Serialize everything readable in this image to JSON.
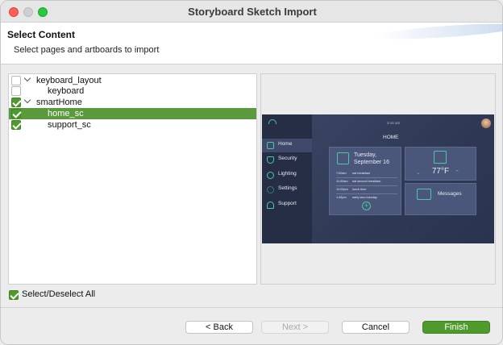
{
  "window": {
    "title": "Storyboard Sketch Import"
  },
  "header": {
    "title": "Select Content",
    "description": "Select pages and artboards to import"
  },
  "tree": {
    "items": [
      {
        "label": "keyboard_layout",
        "checked": false,
        "expanded": true,
        "level": 0,
        "selected": false
      },
      {
        "label": "keyboard",
        "checked": false,
        "level": 1,
        "selected": false
      },
      {
        "label": "smartHome",
        "checked": true,
        "expanded": true,
        "level": 0,
        "selected": false
      },
      {
        "label": "home_sc",
        "checked": true,
        "level": 1,
        "selected": true
      },
      {
        "label": "support_sc",
        "checked": true,
        "level": 1,
        "selected": false
      }
    ]
  },
  "preview": {
    "time": "3:15 am",
    "page_title": "HOME",
    "nav": [
      {
        "label": "Home",
        "icon": "house-icon",
        "active": true
      },
      {
        "label": "Security",
        "icon": "shield-icon",
        "active": false
      },
      {
        "label": "Lighting",
        "icon": "bulb-icon",
        "active": false
      },
      {
        "label": "Settings",
        "icon": "gear-icon",
        "active": false
      },
      {
        "label": "Support",
        "icon": "headset-icon",
        "active": false
      }
    ],
    "calendar": {
      "day": "Tuesday,",
      "date": "September 16",
      "events": [
        {
          "time": "7:00am",
          "text": "eat breakfast"
        },
        {
          "time": "11:00am",
          "text": "eat second breakfast"
        },
        {
          "time": "12:00pm",
          "text": "lunch time"
        },
        {
          "time": "1:45pm",
          "text": "early taco tuesday"
        }
      ]
    },
    "thermostat": {
      "temp": "77°F"
    },
    "messages": {
      "label": "Messages"
    },
    "accent": "#49c9a4"
  },
  "select_all": {
    "label": "Select/Deselect All",
    "checked": true
  },
  "buttons": {
    "back": "< Back",
    "next": "Next >",
    "cancel": "Cancel",
    "finish": "Finish"
  }
}
